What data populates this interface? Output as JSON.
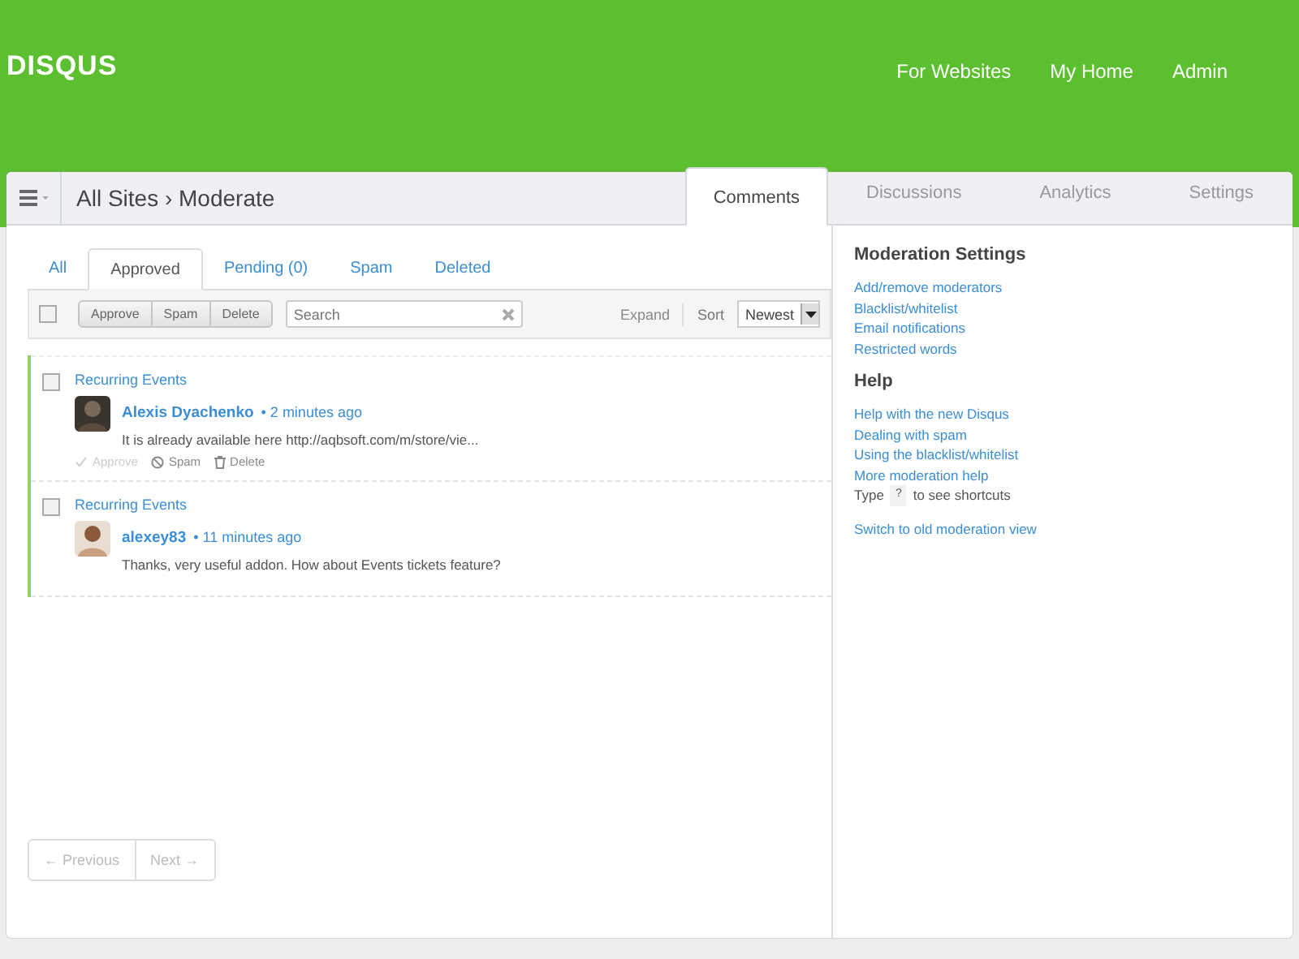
{
  "logo": "DISQUS",
  "nav": [
    "For Websites",
    "My Home",
    "Admin"
  ],
  "breadcrumb": "All Sites › Moderate",
  "main_tabs": [
    {
      "label": "Comments",
      "selected": true
    },
    {
      "label": "Discussions",
      "selected": false
    },
    {
      "label": "Analytics",
      "selected": false
    },
    {
      "label": "Settings",
      "selected": false
    }
  ],
  "filter_tabs": [
    {
      "label": "All",
      "selected": false
    },
    {
      "label": "Approved",
      "selected": true
    },
    {
      "label": "Pending (0)",
      "selected": false
    },
    {
      "label": "Spam",
      "selected": false
    },
    {
      "label": "Deleted",
      "selected": false
    }
  ],
  "toolbar": {
    "select_all": false,
    "bulk_buttons": [
      "Approve",
      "Spam",
      "Delete"
    ],
    "search": {
      "placeholder": "Search"
    },
    "expand": "Expand",
    "sort_label": "Sort",
    "sort_value": "Newest"
  },
  "comments": [
    {
      "checked": false,
      "thread": "Recurring Events",
      "author": "Alexis Dyachenko",
      "time": "• 2 minutes ago",
      "text": "It is already available here http://aqbsoft.com/m/store/vie...",
      "actions": [
        {
          "kind": "approve",
          "label": "Approve",
          "disabled": true
        },
        {
          "kind": "spam",
          "label": "Spam",
          "disabled": false
        },
        {
          "kind": "delete",
          "label": "Delete",
          "disabled": false
        }
      ]
    },
    {
      "checked": false,
      "thread": "Recurring Events",
      "author": "alexey83",
      "time": "• 11 minutes ago",
      "text": "Thanks, very useful addon. How about Events tickets feature?"
    }
  ],
  "pagination": [
    {
      "label": "← Previous",
      "disabled": true
    },
    {
      "label": "Next →",
      "disabled": true
    }
  ],
  "sidebar": {
    "sections": [
      {
        "title": "Moderation Settings",
        "links": [
          "Add/remove moderators",
          "Blacklist/whitelist",
          "Email notifications",
          "Restricted words"
        ]
      },
      {
        "title": "Help",
        "links": [
          "Help with the new Disqus",
          "Dealing with spam",
          "Using the blacklist/whitelist",
          "More moderation help"
        ]
      }
    ],
    "shortcut_hint": {
      "before": "Type",
      "key": "?",
      "after": "to see shortcuts"
    },
    "footer_link": "Switch to old moderation view"
  }
}
